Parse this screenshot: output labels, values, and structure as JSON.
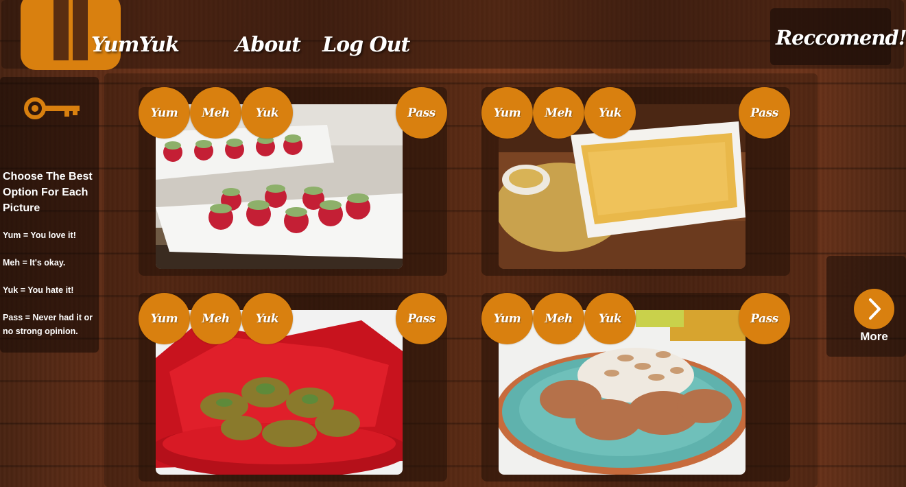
{
  "colors": {
    "accent": "#d9800f",
    "text": "#ffffff"
  },
  "header": {
    "brand": "YumYuk",
    "nav": {
      "about": "About",
      "logout": "Log Out"
    },
    "recommend_label": "Reccomend!"
  },
  "sidebar": {
    "icon": "key-icon",
    "title": "Choose The Best Option For Each Picture",
    "lines": [
      "Yum = You love it!",
      "Meh = It's okay.",
      "Yuk = You hate it!",
      "Pass = Never had it or no strong opinion."
    ]
  },
  "cards": [
    {
      "image": "radish-bites-photo",
      "buttons": {
        "yum": "Yum",
        "meh": "Meh",
        "yuk": "Yuk",
        "pass": "Pass"
      }
    },
    {
      "image": "mustard-dip-photo",
      "buttons": {
        "yum": "Yum",
        "meh": "Meh",
        "yuk": "Yuk",
        "pass": "Pass"
      }
    },
    {
      "image": "fried-jalapenos-photo",
      "buttons": {
        "yum": "Yum",
        "meh": "Meh",
        "yuk": "Yuk",
        "pass": "Pass"
      }
    },
    {
      "image": "almond-dip-crackers-photo",
      "buttons": {
        "yum": "Yum",
        "meh": "Meh",
        "yuk": "Yuk",
        "pass": "Pass"
      }
    }
  ],
  "more": {
    "label": "More",
    "icon": "chevron-right-icon"
  }
}
